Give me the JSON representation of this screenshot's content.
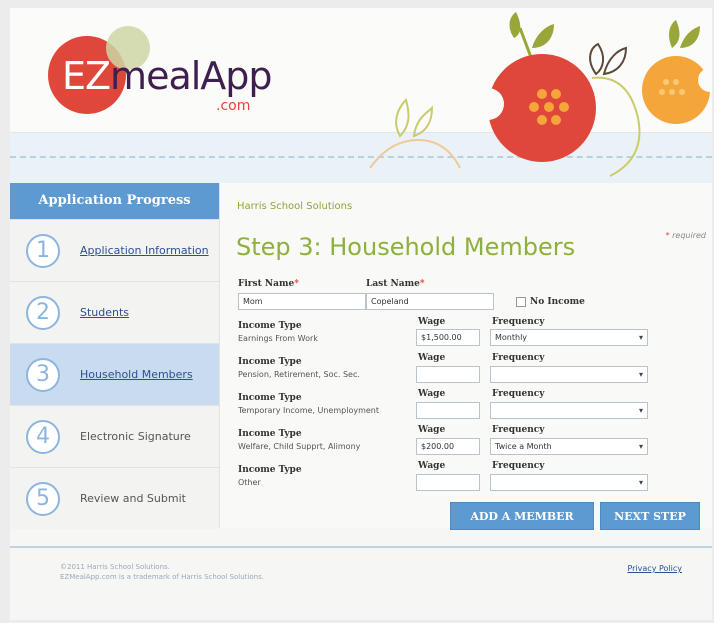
{
  "brand": {
    "logo_ez": "EZ",
    "logo_meal": "meal",
    "logo_app": "App",
    "logo_com": ".com",
    "colors": {
      "primary": "#5d9ad2",
      "accent_green": "#8db13b",
      "accent_red": "#e0473b",
      "accent_orange": "#f5a63a"
    }
  },
  "sidebar": {
    "heading": "Application Progress",
    "steps": [
      {
        "num": "1",
        "label": "Application Information",
        "is_link": true,
        "active": false
      },
      {
        "num": "2",
        "label": "Students",
        "is_link": true,
        "active": false
      },
      {
        "num": "3",
        "label": "Household Members",
        "is_link": true,
        "active": true
      },
      {
        "num": "4",
        "label": "Electronic Signature",
        "is_link": false,
        "active": false
      },
      {
        "num": "5",
        "label": "Review and Submit",
        "is_link": false,
        "active": false
      }
    ]
  },
  "main": {
    "school": "Harris School Solutions",
    "required_note": "required",
    "title": "Step 3: Household Members",
    "first_name_label": "First Name",
    "last_name_label": "Last Name",
    "first_name_value": "Mom",
    "last_name_value": "Copeland",
    "no_income_label": "No Income",
    "income_type_label": "Income Type",
    "wage_label": "Wage",
    "frequency_label": "Frequency",
    "income_rows": [
      {
        "type": "Earnings From Work",
        "wage": "$1,500.00",
        "frequency": "Monthly"
      },
      {
        "type": "Pension, Retirement, Soc. Sec.",
        "wage": "",
        "frequency": ""
      },
      {
        "type": "Temporary Income, Unemployment",
        "wage": "",
        "frequency": ""
      },
      {
        "type": "Welfare, Child Supprt, Alimony",
        "wage": "$200.00",
        "frequency": "Twice a Month"
      },
      {
        "type": "Other",
        "wage": "",
        "frequency": ""
      }
    ],
    "add_member_label": "ADD A MEMBER",
    "next_step_label": "NEXT STEP"
  },
  "footer": {
    "copyright_1": "©2011 Harris School Solutions.",
    "copyright_2": "EZMealApp.com is a trademark of Harris School Solutions.",
    "privacy": "Privacy Policy"
  },
  "icons": [
    "apple-icon",
    "orange-icon",
    "leaf-icon",
    "chevron-down-icon",
    "checkbox-icon"
  ]
}
